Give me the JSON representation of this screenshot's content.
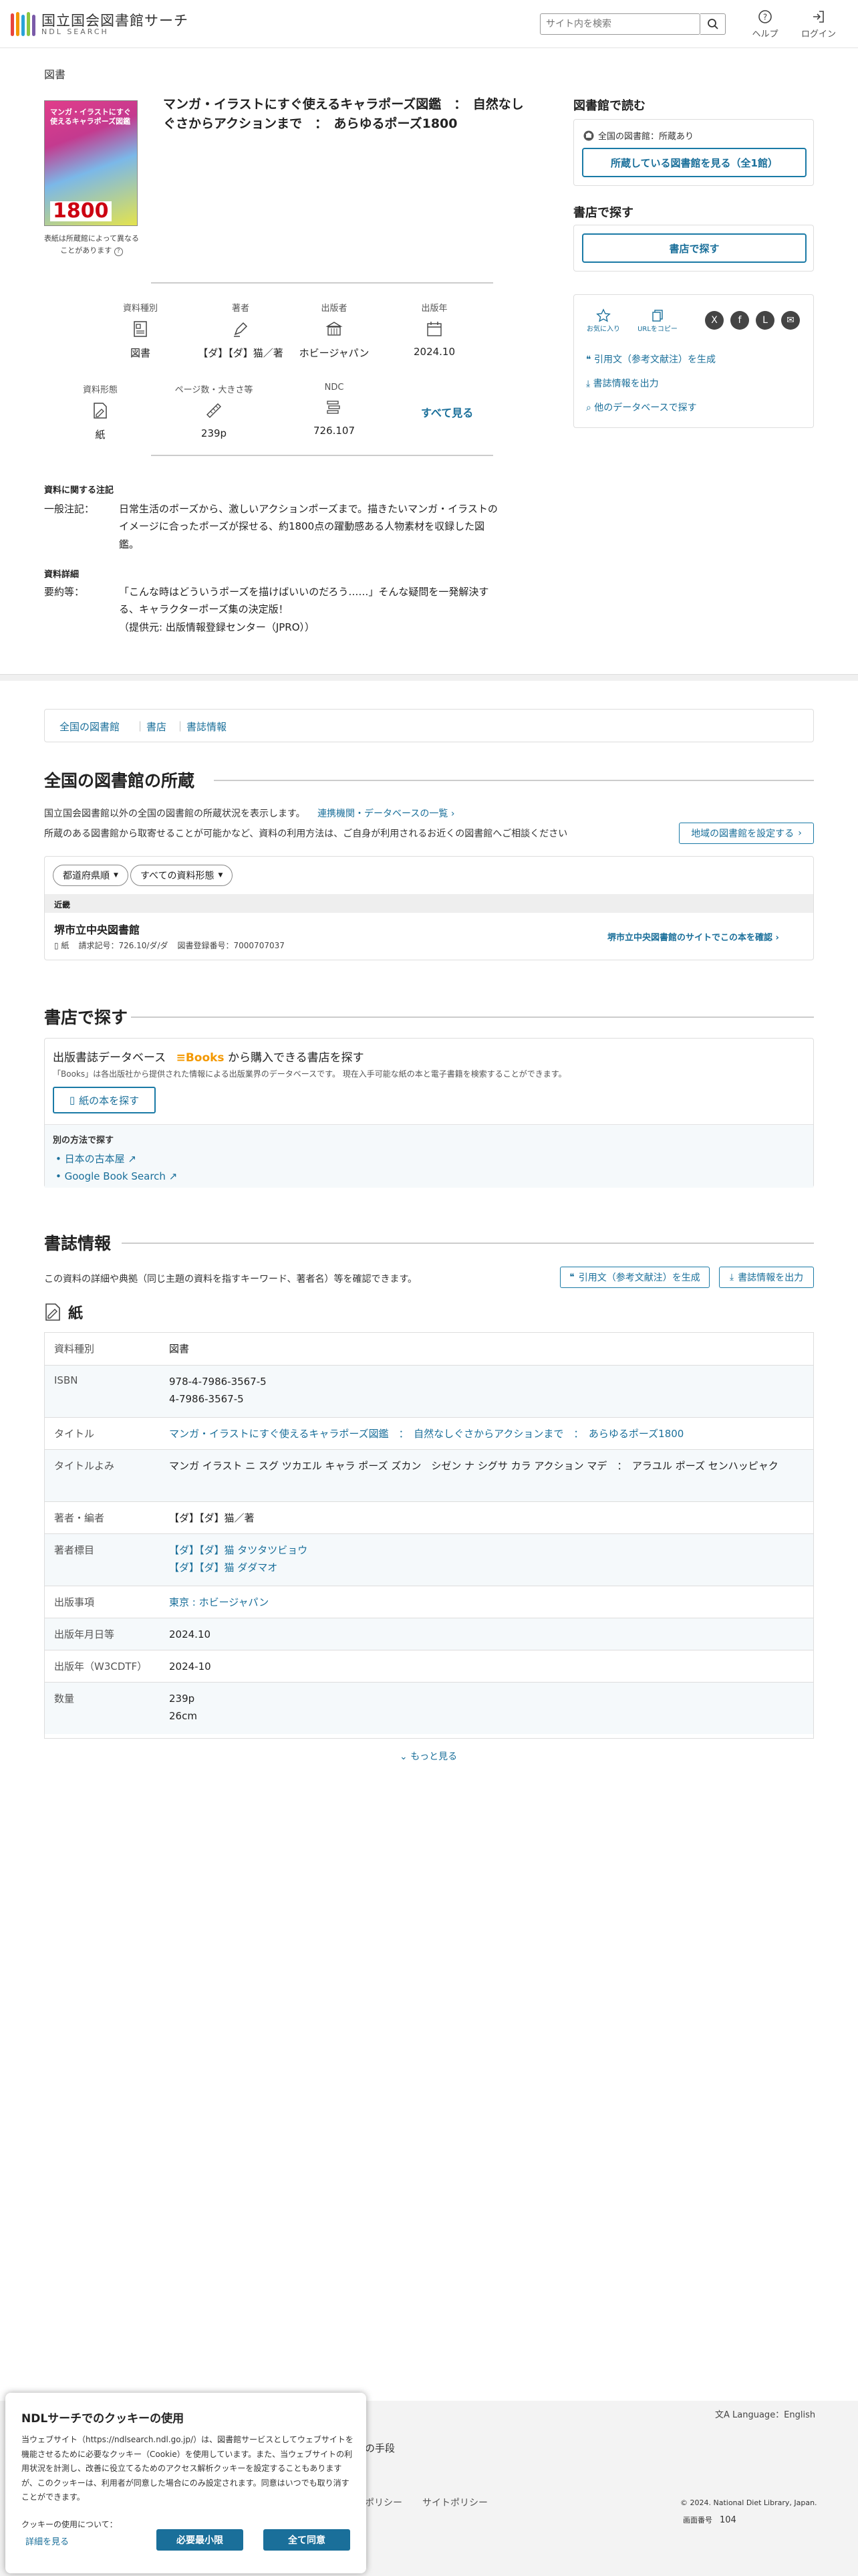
{
  "header": {
    "logo_title": "国立国会図書館サーチ",
    "logo_sub": "NDL SEARCH",
    "search_placeholder": "サイト内を検索",
    "help_label": "ヘルプ",
    "login_label": "ログイン"
  },
  "section_label": "図書",
  "book": {
    "cover_title": "マンガ・イラストにすぐ使えるキャラポーズ図鑑",
    "cover_number": "1800",
    "cover_note": "表紙は所蔵館によって異なることがあります",
    "title": "マンガ・イラストにすぐ使えるキャラポーズ図鑑　：　自然なしぐさからアクションまで　：　あらゆるポーズ1800"
  },
  "meta": [
    {
      "label": "資料種別",
      "value": "図書",
      "icon": "book-type-icon"
    },
    {
      "label": "著者",
      "value": "【ダ】【ダ】猫／著",
      "icon": "pen-icon"
    },
    {
      "label": "出版者",
      "value": "ホビージャパン",
      "icon": "building-icon"
    },
    {
      "label": "出版年",
      "value": "2024.10",
      "icon": "calendar-icon"
    },
    {
      "label": "資料形態",
      "value": "紙",
      "icon": "paper-icon"
    },
    {
      "label": "ページ数・大きさ等",
      "value": "239p",
      "icon": "ruler-icon"
    },
    {
      "label": "NDC",
      "value": "726.107",
      "icon": "ndc-icon"
    }
  ],
  "show_all": "すべて見る",
  "notes": {
    "h1": "資料に関する注記",
    "k1": "一般注記：",
    "v1": "日常生活のポーズから、激しいアクションポーズまで。描きたいマンガ・イラストのイメージに合ったポーズが探せる、約1800点の躍動感ある人物素材を収録した図鑑。",
    "h2": "資料詳細",
    "k2": "要約等：",
    "v2a": "「こんな時はどういうポーズを描けばいいのだろう……」そんな疑問を一発解決する、キャラクターポーズ集の決定版！",
    "v2b": "（提供元: 出版情報登録センター（JPRO））"
  },
  "side": {
    "read_title": "図書館で読む",
    "holding_label": "全国の図書館：所蔵あり",
    "holding_button": "所蔵している図書館を見る（全1館）",
    "shop_title": "書店で探す",
    "shop_button": "書店で探す",
    "fav_label": "お気に入り",
    "url_label": "URLをコピー",
    "x_label": "X",
    "fb_label": "f",
    "line_label": "L",
    "mail_label": "✉",
    "cite_link": "引用文（参考文献注）を生成",
    "export_link": "書誌情報を出力",
    "other_db_link": "他のデータベースで探す"
  },
  "crumbs": [
    "全国の図書館",
    "書店",
    "書誌情報"
  ],
  "libraries": {
    "heading": "全国の図書館の所蔵",
    "desc1": "国立国会図書館以外の全国の図書館の所蔵状況を表示します。",
    "desc_link": "連携機関・データベースの一覧",
    "desc2": "所蔵のある図書館から取寄せることが可能かなど、資料の利用方法は、ご自身が利用されるお近くの図書館へご相談ください",
    "region_button": "地域の図書館を設定する",
    "filter_pref": "都道府県順",
    "filter_type": "すべての資料形態",
    "group_label": "近畿",
    "lib_name": "堺市立中央図書館",
    "lib_form": "紙",
    "call_no": "請求記号：726.10/ダ/ダ",
    "reg_no": "図書登録番号：7000707037",
    "lib_link": "堺市立中央図書館のサイトでこの本を確認"
  },
  "stores": {
    "heading": "書店で探す",
    "db_title": "出版書誌データベース",
    "db_brand": "Books",
    "db_title2": "から購入できる書店を探す",
    "db_desc": "「Books」は各出版社から提供された情報による出版業界のデータベースです。 現在入手可能な紙の本と電子書籍を検索することができます。",
    "paper_button": "紙の本を探す",
    "other_label": "別の方法で探す",
    "other1": "日本の古本屋",
    "other2": "Google Book Search"
  },
  "biblio": {
    "heading": "書誌情報",
    "desc": "この資料の詳細や典拠（同じ主題の資料を指すキーワード、著者名）等を確認できます。",
    "cite_button": "引用文（参考文献注）を生成",
    "export_button": "書誌情報を出力",
    "form_label": "紙",
    "rows": [
      {
        "k": "資料種別",
        "v": [
          "図書"
        ],
        "link": false
      },
      {
        "k": "ISBN",
        "v": [
          "978-4-7986-3567-5",
          "4-7986-3567-5"
        ],
        "link": false
      },
      {
        "k": "タイトル",
        "v": [
          "マンガ・イラストにすぐ使えるキャラポーズ図鑑　：　自然なしぐさからアクションまで　：　あらゆるポーズ1800"
        ],
        "link": true
      },
      {
        "k": "タイトルよみ",
        "v": [
          "マンガ イラスト ニ スグ ツカエル キャラ ポーズ ズカン　シゼン ナ シグサ カラ アクション マデ　：　アラユル ポーズ センハッピャク"
        ],
        "link": false
      },
      {
        "k": "著者・編者",
        "v": [
          "【ダ】【ダ】猫／著"
        ],
        "link": false
      },
      {
        "k": "著者標目",
        "v": [
          "【ダ】【ダ】猫 タツタツビョウ",
          "【ダ】【ダ】猫 ダダマオ"
        ],
        "link": "partial"
      },
      {
        "k": "出版事項",
        "v": [
          "東京 : ホビージャパン"
        ],
        "link": true
      },
      {
        "k": "出版年月日等",
        "v": [
          "2024.10"
        ],
        "link": false
      },
      {
        "k": "出版年（W3CDTF）",
        "v": [
          "2024-10"
        ],
        "link": false
      },
      {
        "k": "数量",
        "v": [
          "239p",
          "26cm"
        ],
        "link": false
      }
    ],
    "more": "もっと見る"
  },
  "footer": {
    "language": "Language：English",
    "means": "の手段",
    "policy": "ポリシー",
    "sitepolicy": "サイトポリシー",
    "copyright": "© 2024. National Diet Library, Japan.",
    "screen_no_label": "画面番号",
    "screen_no": "104"
  },
  "cookie": {
    "title": "NDLサーチでのクッキーの使用",
    "body": "当ウェブサイト（https://ndlsearch.ndl.go.jp/）は、図書館サービスとしてウェブサイトを機能させるために必要なクッキー（Cookie）を使用しています。また、当ウェブサイトの利用状況を計測し、改善に役立てるためのアクセス解析クッキーを設定することもありますが、このクッキーは、利用者が同意した場合にのみ設定されます。同意はいつでも取り消すことができます。",
    "about": "クッキーの使用について：",
    "details": "詳細を見る",
    "min_button": "必要最小限",
    "all_button": "全て同意"
  },
  "colors": {
    "accent": "#1a6f9a",
    "books_orange": "#f39800"
  }
}
